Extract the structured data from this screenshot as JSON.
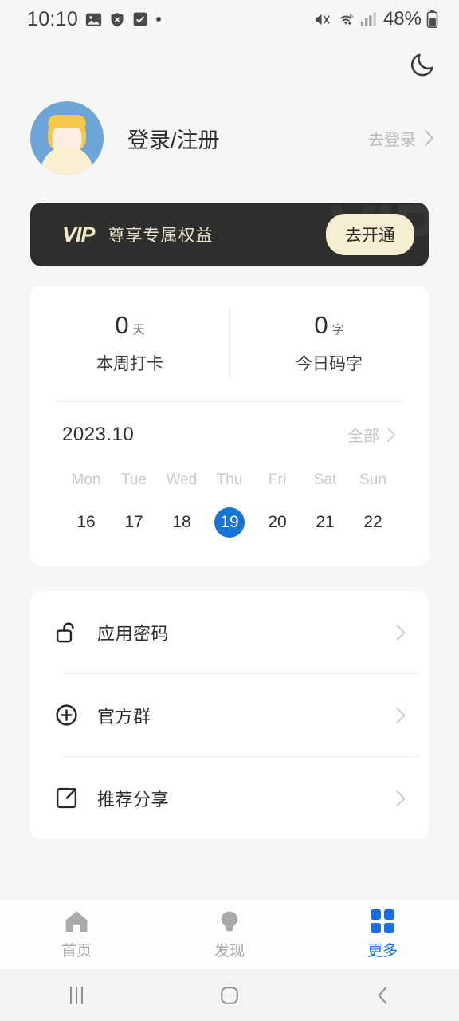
{
  "status_bar": {
    "clock": "10:10",
    "left_icons": [
      "image-icon",
      "shield-x-icon",
      "checkbox-icon",
      "dot-icon"
    ],
    "right_icons": [
      "mute-vibrate-icon",
      "wifi-6-icon",
      "signal-bars-icon",
      "battery-icon"
    ],
    "battery_text": "48%"
  },
  "topbar": {
    "theme_toggle_icon": "moon-icon"
  },
  "profile": {
    "avatar_icon": "default-avatar",
    "name": "登录/注册",
    "action_label": "去登录",
    "action_chevron": "chevron-right-icon"
  },
  "vip": {
    "logo": "VIP",
    "watermark": "VIP",
    "slogan": "尊享专属权益",
    "button_label": "去开通",
    "bg_color": "#2e2e2c",
    "accent_color": "#f6edd3"
  },
  "stats": [
    {
      "value": "0",
      "unit": "天",
      "label": "本周打卡"
    },
    {
      "value": "0",
      "unit": "字",
      "label": "今日码字"
    }
  ],
  "calendar": {
    "month": "2023.10",
    "all_label": "全部",
    "all_chevron": "chevron-right-icon",
    "weekdays": [
      "Mon",
      "Tue",
      "Wed",
      "Thu",
      "Fri",
      "Sat",
      "Sun"
    ],
    "days": [
      "16",
      "17",
      "18",
      "19",
      "20",
      "21",
      "22"
    ],
    "selected_day": "19",
    "selected_color": "#1874d6"
  },
  "menu": [
    {
      "icon": "unlock-icon",
      "label": "应用密码",
      "chevron": "chevron-right-icon"
    },
    {
      "icon": "plus-circle-icon",
      "label": "官方群",
      "chevron": "chevron-right-icon"
    },
    {
      "icon": "share-export-icon",
      "label": "推荐分享",
      "chevron": "chevron-right-icon"
    }
  ],
  "tabbar": {
    "active_color": "#1a6fe0",
    "inactive_color": "#a8a8a8",
    "tabs": [
      {
        "icon": "home-icon",
        "label": "首页",
        "active": false
      },
      {
        "icon": "lightbulb-icon",
        "label": "发现",
        "active": false
      },
      {
        "icon": "grid-icon",
        "label": "更多",
        "active": true
      }
    ]
  },
  "navbar": {
    "buttons": [
      {
        "icon": "recents-icon",
        "name": "recents"
      },
      {
        "icon": "home-square-icon",
        "name": "home"
      },
      {
        "icon": "back-chevron-icon",
        "name": "back"
      }
    ]
  }
}
